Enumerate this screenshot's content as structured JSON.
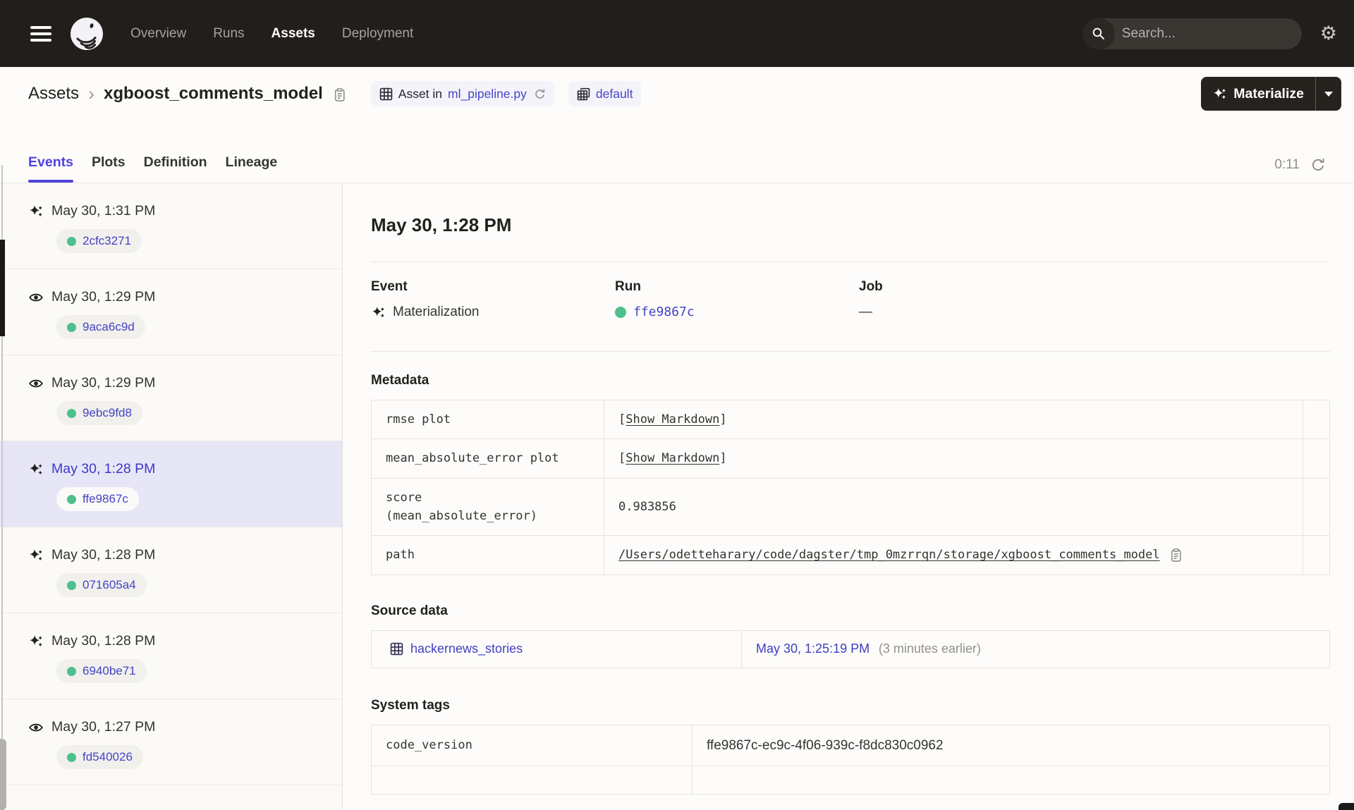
{
  "nav": {
    "items": [
      {
        "label": "Overview"
      },
      {
        "label": "Runs"
      },
      {
        "label": "Assets"
      },
      {
        "label": "Deployment"
      }
    ],
    "active": "Assets",
    "search_placeholder": "Search...",
    "search_shortcut": "/"
  },
  "header": {
    "breadcrumb_root": "Assets",
    "breadcrumb_separator": "›",
    "asset_name": "xgboost_comments_model",
    "asset_tag_prefix": "Asset in",
    "asset_tag_link": "ml_pipeline.py",
    "group_tag": "default",
    "materialize_label": "Materialize"
  },
  "tabs": {
    "items": [
      {
        "label": "Events"
      },
      {
        "label": "Plots"
      },
      {
        "label": "Definition"
      },
      {
        "label": "Lineage"
      }
    ],
    "active": "Events",
    "timer": "0:11"
  },
  "sidebar": {
    "events": [
      {
        "icon": "materialization",
        "time": "May 30, 1:31 PM",
        "run": "2cfc3271",
        "selected": false
      },
      {
        "icon": "observation",
        "time": "May 30, 1:29 PM",
        "run": "9aca6c9d",
        "selected": false
      },
      {
        "icon": "observation",
        "time": "May 30, 1:29 PM",
        "run": "9ebc9fd8",
        "selected": false
      },
      {
        "icon": "materialization",
        "time": "May 30, 1:28 PM",
        "run": "ffe9867c",
        "selected": true
      },
      {
        "icon": "materialization",
        "time": "May 30, 1:28 PM",
        "run": "071605a4",
        "selected": false
      },
      {
        "icon": "materialization",
        "time": "May 30, 1:28 PM",
        "run": "6940be71",
        "selected": false
      },
      {
        "icon": "observation",
        "time": "May 30, 1:27 PM",
        "run": "fd540026",
        "selected": false
      }
    ]
  },
  "detail": {
    "title": "May 30, 1:28 PM",
    "event_label": "Event",
    "event_value": "Materialization",
    "run_label": "Run",
    "run_value": "ffe9867c",
    "job_label": "Job",
    "job_value": "—",
    "metadata": {
      "heading": "Metadata",
      "rows": [
        {
          "key": "rmse plot",
          "type": "markdown",
          "open": "[",
          "label": "Show Markdown",
          "close": "]"
        },
        {
          "key": "mean_absolute_error plot",
          "type": "markdown",
          "open": "[",
          "label": "Show Markdown",
          "close": "]"
        },
        {
          "key": "score\n(mean_absolute_error)",
          "type": "text",
          "value": "0.983856"
        },
        {
          "key": "path",
          "type": "path",
          "value": "/Users/odetteharary/code/dagster/tmp_0mzrrqn/storage/xgboost_comments_model"
        }
      ]
    },
    "source_data": {
      "heading": "Source data",
      "asset": "hackernews_stories",
      "time": "May 30, 1:25:19 PM",
      "note": "(3 minutes earlier)"
    },
    "system_tags": {
      "heading": "System tags",
      "rows": [
        {
          "key": "code_version",
          "value": "ffe9867c-ec9c-4f06-939c-f8dc830c0962"
        }
      ]
    }
  },
  "colors": {
    "nav_bg": "#211E1B",
    "accent": "#4F43DD",
    "tag_link": "#4645C8",
    "run_link": "#4543C4",
    "success_dot": "#4EC08D",
    "selected_row_bg": "#E7E6F7"
  }
}
